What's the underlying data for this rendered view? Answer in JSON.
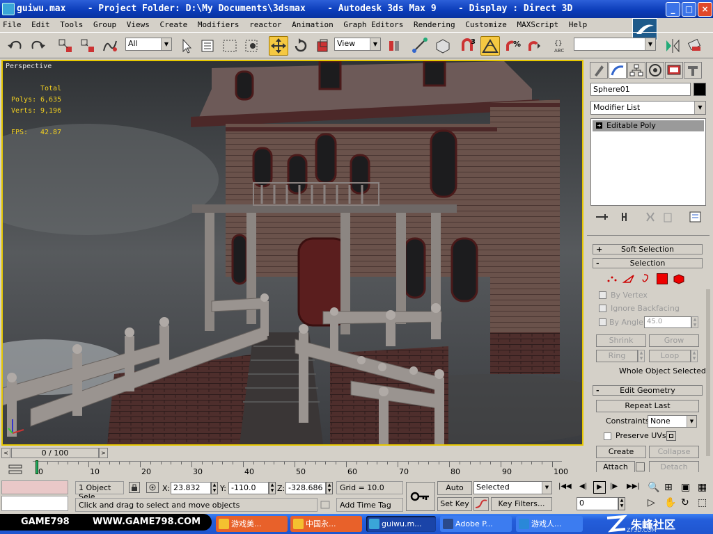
{
  "window": {
    "title": "guiwu.max    - Project Folder: D:\\My Documents\\3dsmax    - Autodesk 3ds Max 9    - Display : Direct 3D",
    "min": "_",
    "max": "□",
    "close": "×"
  },
  "menu": [
    "File",
    "Edit",
    "Tools",
    "Group",
    "Views",
    "Create",
    "Modifiers",
    "reactor",
    "Animation",
    "Graph Editors",
    "Rendering",
    "Customize",
    "MAXScript",
    "Help"
  ],
  "toolbar": {
    "filter_value": "All",
    "coord_value": "View",
    "snap_count": "3"
  },
  "viewport": {
    "label": "Perspective",
    "stats_header": "Total",
    "polys_label": "Polys:",
    "polys_value": "6,635",
    "verts_label": "Verts:",
    "verts_value": "9,196",
    "fps_label": "FPS:",
    "fps_value": "42.87"
  },
  "command_panel": {
    "object_name": "Sphere01",
    "modifier_list": "Modifier List",
    "stack_item": "Editable Poly",
    "soft_selection": "Soft Selection",
    "selection": "Selection",
    "by_vertex": "By Vertex",
    "ignore_backfacing": "Ignore Backfacing",
    "by_angle": "By Angle:",
    "by_angle_value": "45.0",
    "shrink": "Shrink",
    "grow": "Grow",
    "ring": "Ring",
    "loop": "Loop",
    "selection_status": "Whole Object Selected",
    "edit_geometry": "Edit Geometry",
    "repeat_last": "Repeat Last",
    "constraints_label": "Constraints:",
    "constraints_value": "None",
    "preserve_uvs": "Preserve UVs",
    "create": "Create",
    "collapse": "Collapse",
    "attach": "Attach",
    "detach": "Detach"
  },
  "timeline": {
    "frame_display": "0 / 100",
    "ticks": [
      "0",
      "10",
      "20",
      "30",
      "40",
      "50",
      "60",
      "70",
      "80",
      "90",
      "100"
    ],
    "current_frame": 0,
    "total_frames": 100
  },
  "status": {
    "selection_count": "1 Object Sele",
    "x_label": "X:",
    "x_value": "23.832",
    "y_label": "Y:",
    "y_value": "-110.0",
    "z_label": "Z:",
    "z_value": "-328.686",
    "grid": "Grid = 10.0",
    "prompt": "Click and drag to select and move objects",
    "add_time_tag": "Add Time Tag",
    "auto_key": "Auto Key",
    "set_key": "Set Key",
    "key_mode": "Selected",
    "key_filters": "Key Filters...",
    "frame_field": "0"
  },
  "overlay": {
    "brand": "GAME798",
    "url": "WWW.GAME798.COM",
    "watermark": "朱峰社区",
    "watermark_sub": "ZF3D.COM"
  },
  "taskbar": {
    "items": [
      "游戏美...",
      "中国永...",
      "guiwu.m...",
      "Adobe P...",
      "游戏人..."
    ]
  },
  "colors": {
    "title_blue": "#0a3bb8",
    "viewport_border": "#e6c700",
    "stats_yellow": "#f2d020",
    "active_tool": "#f5c842",
    "taskbar_blue": "#245edb"
  }
}
